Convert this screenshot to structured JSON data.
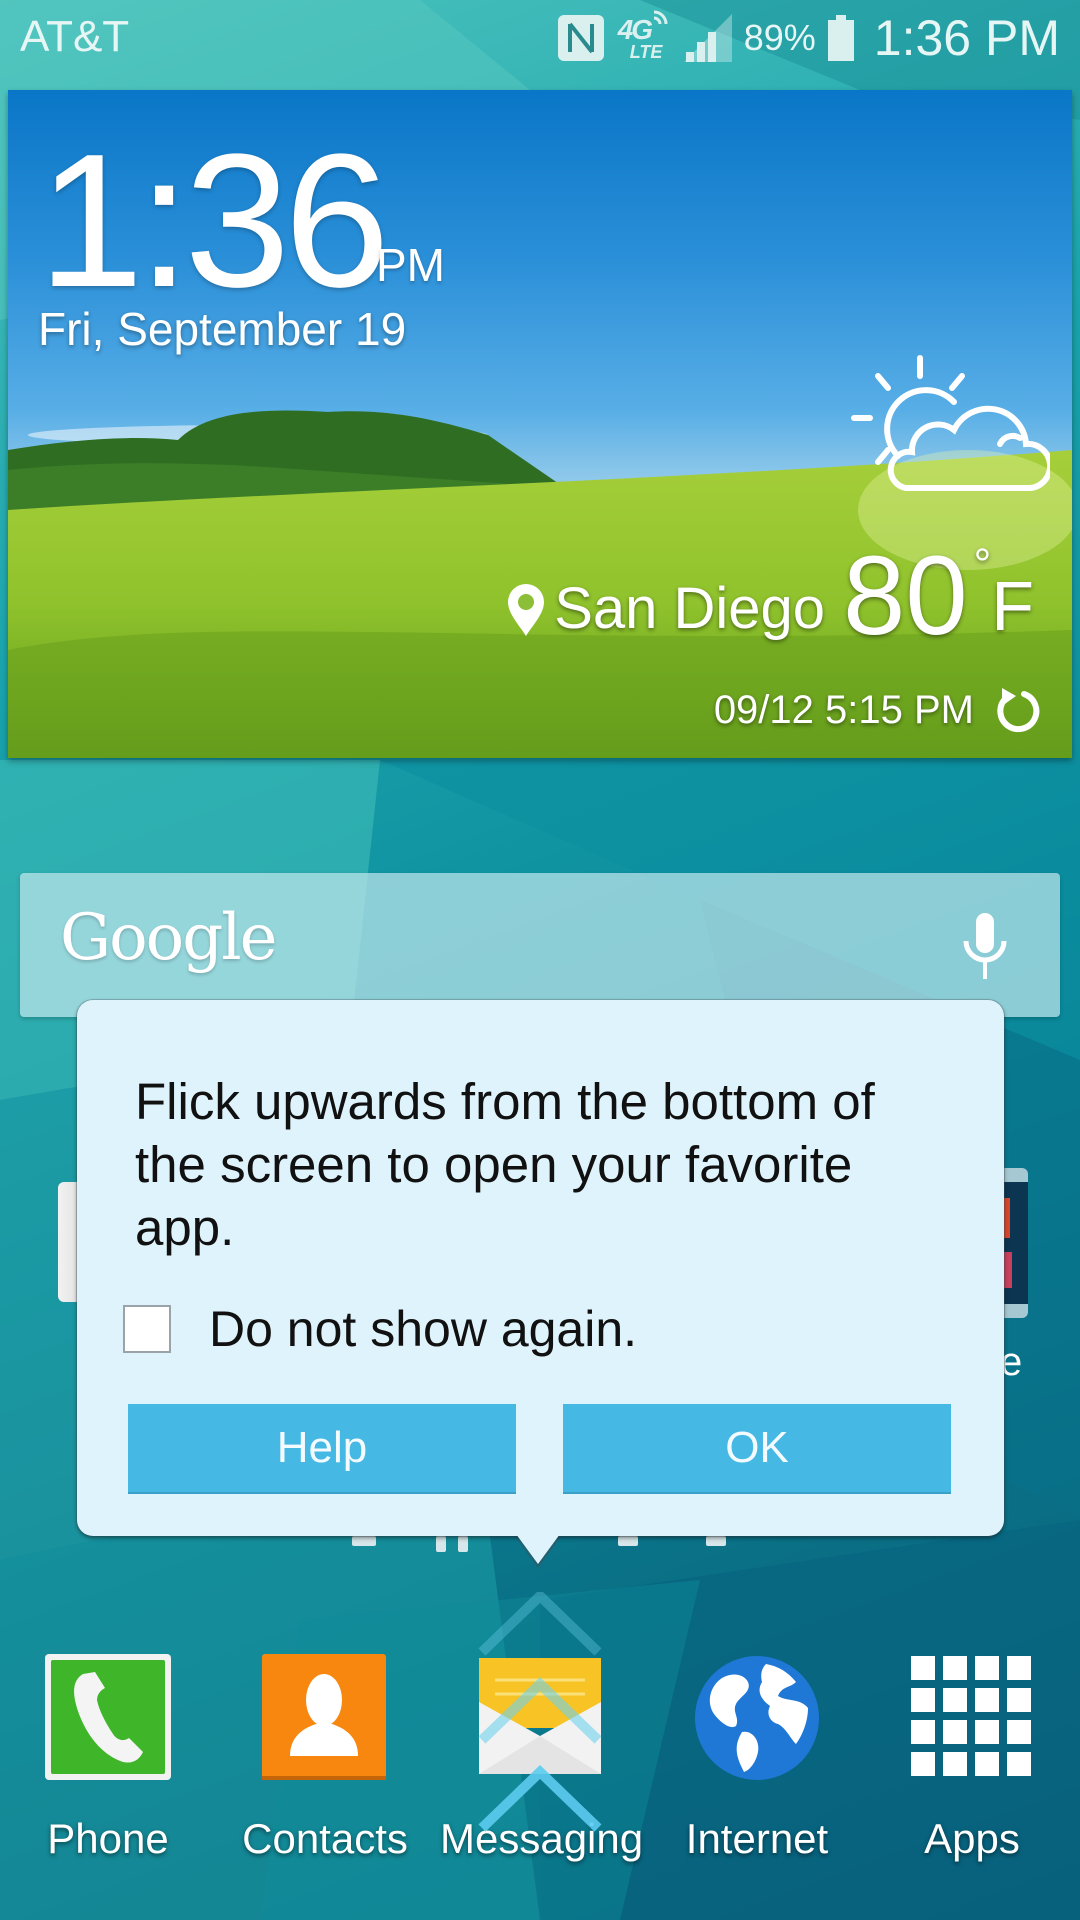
{
  "status_bar": {
    "carrier": "AT&T",
    "nfc_icon": "nfc-icon",
    "network": {
      "top": "4G",
      "bottom": "LTE"
    },
    "signal_icon": "signal-strength-icon",
    "battery_percent": "89%",
    "battery_icon": "battery-icon",
    "time": "1:36 PM"
  },
  "weather_widget": {
    "time": "1:36",
    "ampm": "PM",
    "date": "Fri, September 19",
    "condition_icon": "partly-cloudy-icon",
    "location_icon": "location-pin-icon",
    "city": "San Diego",
    "temperature": "80",
    "degree_symbol": "°",
    "unit": "F",
    "updated": "09/12 5:15 PM",
    "refresh_icon": "refresh-icon"
  },
  "google_bar": {
    "logo": "Google",
    "mic_icon": "microphone-icon"
  },
  "tip_popup": {
    "message": "Flick upwards from the bottom of the screen to open your favorite app.",
    "checkbox_label": "Do not show again.",
    "checkbox_checked": false,
    "help_label": "Help",
    "ok_label": "OK"
  },
  "partial_label_right": "e",
  "dock": {
    "items": [
      {
        "label": "Phone",
        "icon": "phone-icon",
        "color": "#3fb52a"
      },
      {
        "label": "Contacts",
        "icon": "contacts-icon",
        "color": "#f7870f"
      },
      {
        "label": "Messaging",
        "icon": "messaging-icon",
        "color": "#f7c325"
      },
      {
        "label": "Internet",
        "icon": "globe-icon",
        "color": "#1f78d6"
      },
      {
        "label": "Apps",
        "icon": "apps-grid-icon",
        "color": "#ffffff"
      }
    ]
  },
  "colors": {
    "tip_background": "#def3fb",
    "tip_button": "#45b8e4",
    "wallpaper_accent": "#0b8a9b"
  }
}
